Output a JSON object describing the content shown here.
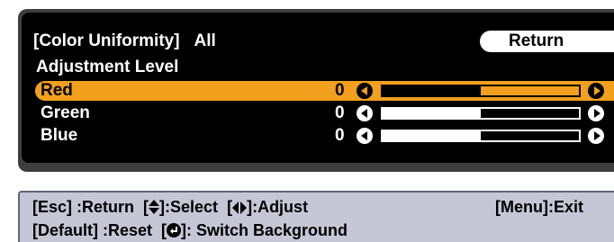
{
  "menu": {
    "title": "[Color Uniformity]",
    "scope": "All",
    "return_label": "Return",
    "section_label": "Adjustment Level",
    "rows": [
      {
        "name": "Red",
        "value": "0",
        "level": 0.5,
        "selected": true
      },
      {
        "name": "Green",
        "value": "0",
        "level": 0.5,
        "selected": false
      },
      {
        "name": "Blue",
        "value": "0",
        "level": 0.5,
        "selected": false
      }
    ]
  },
  "help": {
    "esc": "[Esc] :Return",
    "select_pre": "[",
    "select_post": "]:Select",
    "adjust_pre": "[",
    "adjust_post": "]:Adjust",
    "menu_exit": "[Menu]:Exit",
    "default_reset": "[Default] :Reset",
    "enter_pre": "[",
    "enter_post": "]: Switch Background"
  },
  "colors": {
    "selected": "#f2a01e",
    "panel_bg": "#000000",
    "help_bg": "#c5c6d6"
  },
  "icons": {
    "left_arrow": "left-arrow-button-icon",
    "right_arrow": "right-arrow-button-icon",
    "up_down": "up-down-arrow-icon",
    "left_right": "left-right-arrow-icon",
    "enter": "enter-icon"
  }
}
